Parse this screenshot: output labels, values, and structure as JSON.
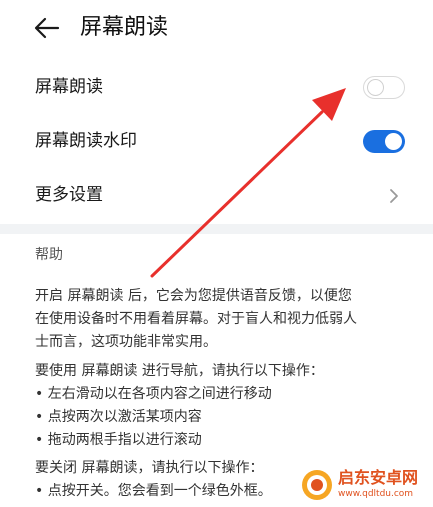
{
  "header": {
    "title": "屏幕朗读"
  },
  "settings": {
    "screen_reader_label": "屏幕朗读",
    "screen_reader_on": false,
    "watermark_label": "屏幕朗读水印",
    "watermark_on": true,
    "more_settings_label": "更多设置"
  },
  "help": {
    "heading": "帮助",
    "para1": [
      "开启 屏幕朗读 后，它会为您提供语音反馈，以便您",
      "在使用设备时不用看着屏幕。对于盲人和视力低弱人",
      "士而言，这项功能非常实用。"
    ],
    "para2": [
      "要使用 屏幕朗读 进行导航，请执行以下操作：",
      "• 左右滑动以在各项内容之间进行移动",
      "• 点按两次以激活某项内容",
      "• 拖动两根手指以进行滚动"
    ],
    "para3": [
      "要关闭 屏幕朗读，请执行以下操作：",
      "• 点按开关。您会看到一个绿色外框。"
    ]
  },
  "watermark_logo": {
    "name": "启东安卓网",
    "url": "www.qdltdu.com"
  },
  "colors": {
    "accent_blue": "#1a6fe0",
    "annotation_red": "#e8302c",
    "watermark_orange": "#e0521f"
  }
}
